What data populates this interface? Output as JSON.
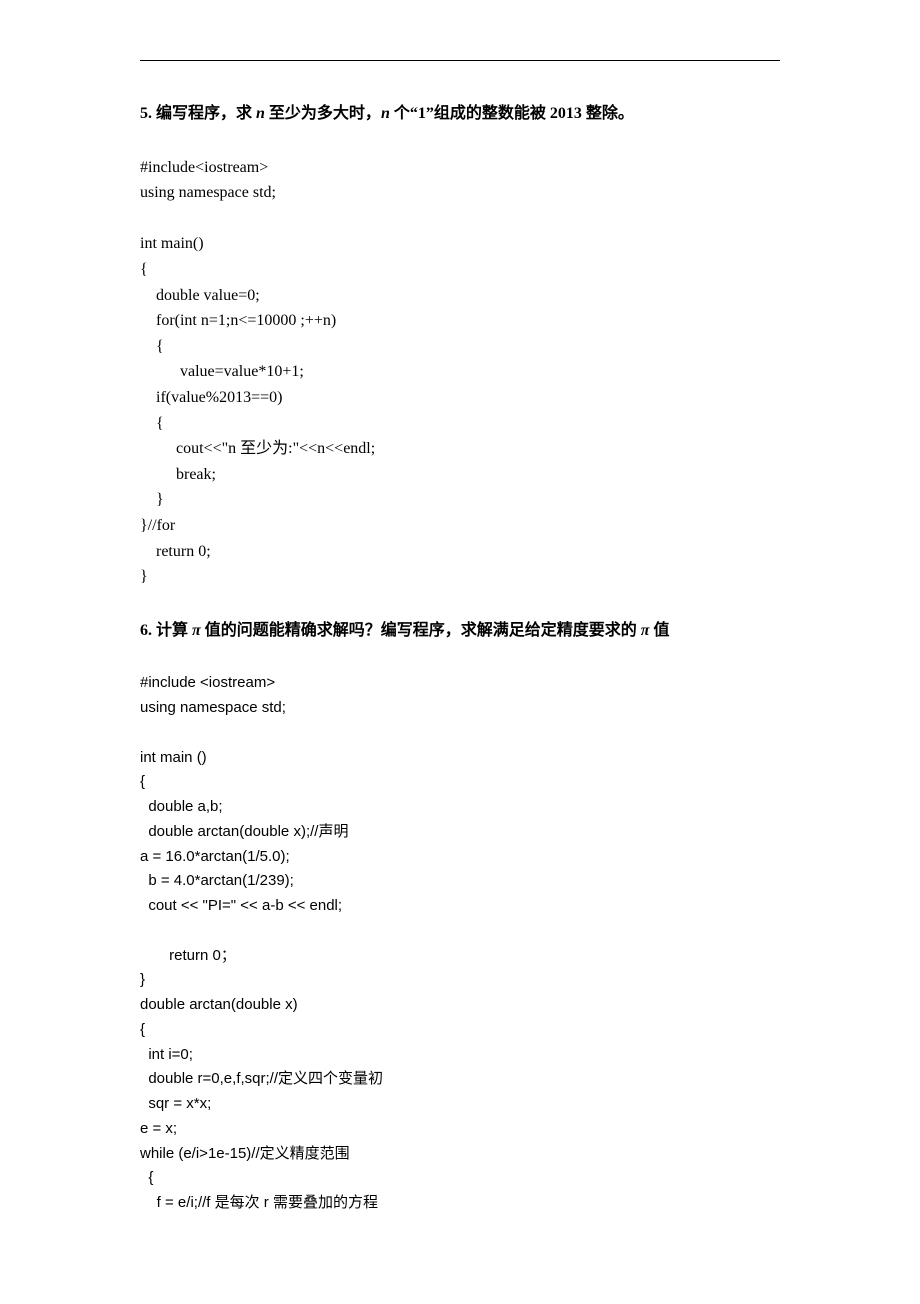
{
  "q5": {
    "heading_prefix": "5. 编写程序，求",
    "heading_mid1": " n ",
    "heading_mid1_text": "至少为多大时，",
    "heading_mid2": "n ",
    "heading_suffix": "个“1”组成的整数能被 2013 整除。",
    "code": "#include<iostream>\nusing namespace std;\n\nint main()\n{\n    double value=0;\n    for(int n=1;n<=10000 ;++n)\n    {\n          value=value*10+1;\n    if(value%2013==0)\n    {\n         cout<<\"n 至少为:\"<<n<<endl;\n         break;\n    }\n}//for\n    return 0;\n}"
  },
  "q6": {
    "heading_prefix": "6. 计算 ",
    "heading_pi1": "π ",
    "heading_mid1": "值的问题能精确求解吗？编写程序，求解满足给定精度要求的 ",
    "heading_pi2": "π ",
    "heading_suffix": "值",
    "code": "#include <iostream>\nusing namespace std;\n\nint main ()\n{\n  double a,b;\n  double arctan(double x);//声明\na = 16.0*arctan(1/5.0);\n  b = 4.0*arctan(1/239);\n  cout << \"PI=\" << a-b << endl;\n\n       return 0；\n}\ndouble arctan(double x)\n{\n  int i=0;\n  double r=0,e,f,sqr;//定义四个变量初\n  sqr = x*x;\ne = x;\nwhile (e/i>1e-15)//定义精度范围\n  {\n    f = e/i;//f 是每次 r 需要叠加的方程"
  }
}
